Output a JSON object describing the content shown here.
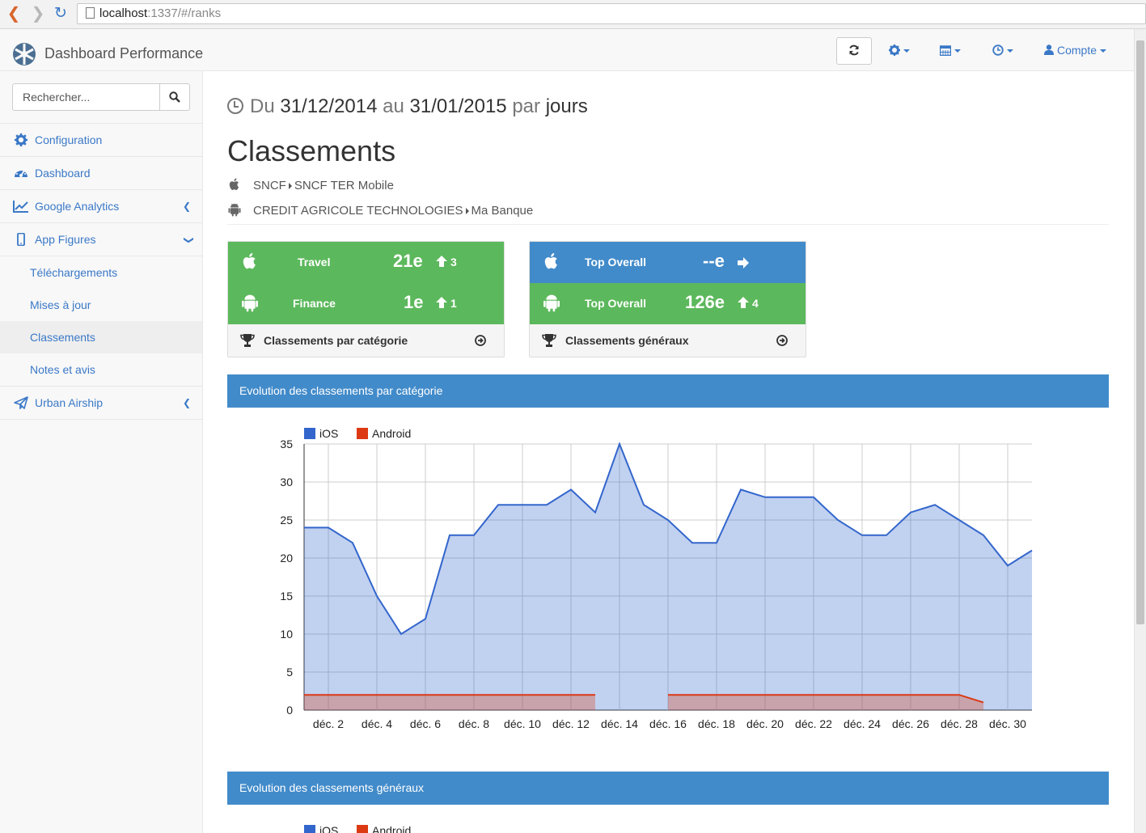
{
  "browser": {
    "url_host": "localhost",
    "url_rest": ":1337/#/ranks"
  },
  "navbar": {
    "brand": "Dashboard Performance",
    "account_label": "Compte"
  },
  "sidebar": {
    "search_placeholder": "Rechercher...",
    "items": [
      {
        "label": "Configuration"
      },
      {
        "label": "Dashboard"
      },
      {
        "label": "Google Analytics"
      },
      {
        "label": "App Figures"
      },
      {
        "label": "Urban Airship"
      }
    ],
    "subitems": [
      {
        "label": "Téléchargements"
      },
      {
        "label": "Mises à jour"
      },
      {
        "label": "Classements"
      },
      {
        "label": "Notes et avis"
      }
    ]
  },
  "header": {
    "prefix": "Du",
    "date_from": "31/12/2014",
    "mid": "au",
    "date_to": "31/01/2015",
    "by": "par",
    "period": "jours",
    "title": "Classements"
  },
  "apps": {
    "ios": {
      "publisher": "SNCF",
      "app": "SNCF TER Mobile"
    },
    "android": {
      "publisher": "CREDIT AGRICOLE TECHNOLOGIES",
      "app": "Ma Banque"
    }
  },
  "cards": {
    "category": {
      "ios": {
        "label": "Travel",
        "rank": "21e",
        "delta": "3"
      },
      "android": {
        "label": "Finance",
        "rank": "1e",
        "delta": "1"
      },
      "footer": "Classements par catégorie"
    },
    "overall": {
      "ios": {
        "label": "Top Overall",
        "rank": "--e"
      },
      "android": {
        "label": "Top Overall",
        "rank": "126e",
        "delta": "4"
      },
      "footer": "Classements généraux"
    }
  },
  "panels": {
    "category_title": "Evolution des classements par catégorie",
    "overall_title": "Evolution des classements généraux"
  },
  "colors": {
    "ios": "#3366cc",
    "android": "#dc3912",
    "green": "#5cb85c",
    "blue": "#428bca",
    "link": "#3a78c7"
  },
  "chart_data": {
    "type": "area",
    "legend": [
      "iOS",
      "Android"
    ],
    "x_ticks": [
      "déc. 2",
      "déc. 4",
      "déc. 6",
      "déc. 8",
      "déc. 10",
      "déc. 12",
      "déc. 14",
      "déc. 16",
      "déc. 18",
      "déc. 20",
      "déc. 22",
      "déc. 24",
      "déc. 26",
      "déc. 28",
      "déc. 30"
    ],
    "x": [
      1,
      2,
      3,
      4,
      5,
      6,
      7,
      8,
      9,
      10,
      11,
      12,
      13,
      14,
      15,
      16,
      17,
      18,
      19,
      20,
      21,
      22,
      23,
      24,
      25,
      26,
      27,
      28,
      29,
      30,
      31
    ],
    "ylim": [
      0,
      35
    ],
    "yticks": [
      0,
      5,
      10,
      15,
      20,
      25,
      30,
      35
    ],
    "grid": true,
    "legend_position": "top-left",
    "series": [
      {
        "name": "iOS",
        "values": [
          24,
          24,
          22,
          15,
          10,
          12,
          23,
          23,
          27,
          27,
          27,
          29,
          26,
          35,
          27,
          25,
          22,
          22,
          29,
          28,
          28,
          28,
          25,
          23,
          23,
          26,
          27,
          25,
          23,
          19,
          21
        ]
      },
      {
        "name": "Android",
        "values": [
          2,
          2,
          2,
          2,
          2,
          2,
          2,
          2,
          2,
          2,
          2,
          2,
          2,
          null,
          null,
          2,
          2,
          2,
          2,
          2,
          2,
          2,
          2,
          2,
          2,
          2,
          2,
          2,
          1,
          null,
          1
        ]
      }
    ]
  },
  "chart2_legend": [
    "iOS",
    "Android"
  ]
}
